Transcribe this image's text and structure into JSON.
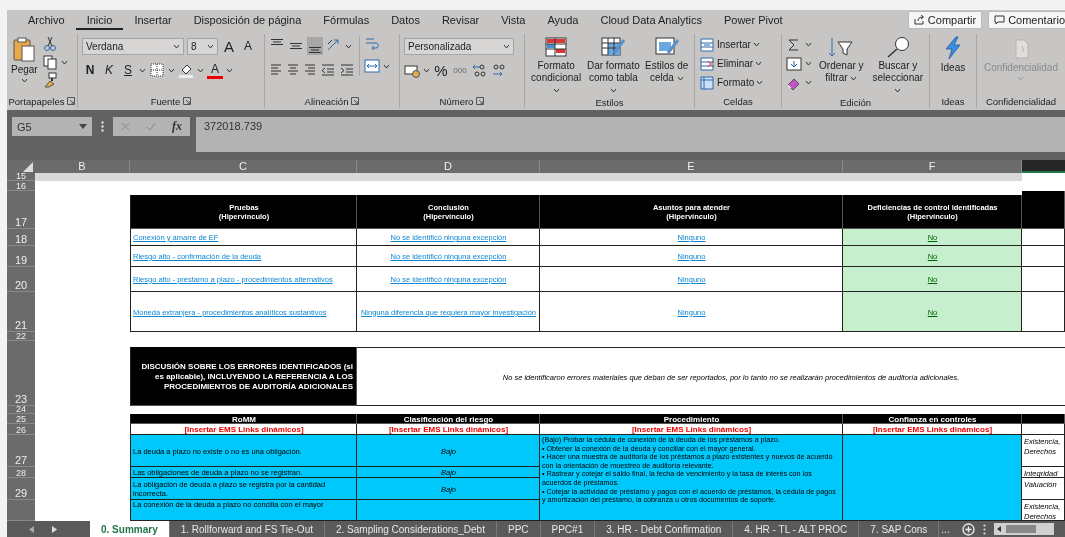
{
  "menu_tabs": [
    {
      "label": "Archivo",
      "selected": false
    },
    {
      "label": "Inicio",
      "selected": true
    },
    {
      "label": "Insertar",
      "selected": false
    },
    {
      "label": "Disposición de página",
      "selected": false
    },
    {
      "label": "Fórmulas",
      "selected": false
    },
    {
      "label": "Datos",
      "selected": false
    },
    {
      "label": "Revisar",
      "selected": false
    },
    {
      "label": "Vista",
      "selected": false
    },
    {
      "label": "Ayuda",
      "selected": false
    },
    {
      "label": "Cloud Data Analytics",
      "selected": false
    },
    {
      "label": "Power Pivot",
      "selected": false
    }
  ],
  "share_button": "Compartir",
  "comments_button": "Comentario",
  "ribbon": {
    "clipboard": {
      "label": "Portapapeles",
      "paste": "Pegar"
    },
    "font": {
      "label": "Fuente",
      "font_name": "Verdana",
      "font_size": "8",
      "grow": "A",
      "shrink": "A",
      "bold": "N",
      "italic": "K",
      "underline": "S",
      "font_color": "A"
    },
    "alignment": {
      "label": "Alineación",
      "vertical_align": [
        {
          "selected": false
        },
        {
          "selected": false
        },
        {
          "selected": true
        }
      ]
    },
    "number": {
      "label": "Número",
      "format": "Personalizada",
      "percent": "%",
      "thousands": "000"
    },
    "styles": {
      "label": "Estilos",
      "buttons": [
        "Formato condicional",
        "Dar formato como tabla",
        "Estilos de celda"
      ]
    },
    "cells": {
      "label": "Celdas",
      "buttons": [
        "Insertar",
        "Eliminar",
        "Formato"
      ]
    },
    "editing": {
      "label": "Edición",
      "buttons": [
        "Ordenar y filtrar",
        "Buscar y seleccionar"
      ]
    },
    "ideas": {
      "label": "Ideas",
      "button": "Ideas"
    },
    "sensitivity": {
      "label": "Confidencialidad",
      "button": "Confidencialidad",
      "disabled": true
    }
  },
  "formula_bar": {
    "name_box": "G5",
    "fx": "fx",
    "formula": "372018.739"
  },
  "columns": [
    {
      "label": "B"
    },
    {
      "label": "C"
    },
    {
      "label": "D"
    },
    {
      "label": "E"
    },
    {
      "label": "F"
    }
  ],
  "row_numbers": [
    "15",
    "16",
    "17",
    "18",
    "19",
    "20",
    "21",
    "22",
    "23",
    "24",
    "25",
    "26",
    "27",
    "28",
    "29"
  ],
  "summary_table": {
    "headers": [
      "Pruebas\n(Hipervínculo)",
      "Conclusión\n(Hipervínculo)",
      "Asuntos para atender\n(Hipervínculo)",
      "Deficiencias de control identificadas\n(Hipervínculo)"
    ],
    "rows": [
      {
        "test": "Conexión y amarre de EF",
        "conclusion": "No se identificó ninguna excepción",
        "matters": "Ninguno",
        "deficiencies": "No",
        "deficiency_found": false
      },
      {
        "test": "Riesgo alto - confirmación de la deuda",
        "conclusion": "No se identificó ninguna excepción",
        "matters": "Ninguno",
        "deficiencies": "No",
        "deficiency_found": false
      },
      {
        "test": "Riesgo alto - préstamo a plazo - procedimientos alternativos",
        "conclusion": "No se identificó ninguna excepción",
        "matters": "Ninguno",
        "deficiencies": "No",
        "deficiency_found": false
      },
      {
        "test": "Moneda extranjera - procedimientos analíticos sustantivos",
        "conclusion": "Ninguna diferencia que requiera mayor investigación",
        "matters": "Ninguno",
        "deficiencies": "No",
        "deficiency_found": false
      }
    ]
  },
  "discussion": {
    "title": "DISCUSIÓN SOBRE LOS ERRORES IDENTIFICADOS (si es aplicable), INCLUYENDO LA REFERENCIA A LOS PROCEDIMIENTOS DE AUDITORÍA ADICIONALES",
    "text": "No se identificaron errores materiales que deban de ser reportados, por lo tanto no se realizarán procedimientos de auditoría adicionales."
  },
  "risk_table": {
    "headers": [
      "RoMM",
      "Clasificación del riesgo",
      "Procedimiento",
      "Confianza en controles"
    ],
    "links": [
      "[Insertar EMS Links dinámicos]",
      "[Insertar EMS Links dinámicos]",
      "[Insertar EMS Links dinámicos]",
      "[Insertar EMS Links dinámicos]"
    ],
    "rows": [
      {
        "romm": "La deuda a plazo no existe o no es una obligación.",
        "rating": "Bajo",
        "assertion": "Existencia, Derechos"
      },
      {
        "romm": "Las obligaciones de deuda a plazo no se registran.",
        "rating": "Bajo",
        "assertion": "Integridad"
      },
      {
        "romm": "La obligación de deuda a plazo se registra por la cantidad incorrecta.",
        "rating": "Bajo",
        "assertion": "Valuación"
      },
      {
        "romm": "La conexión de la deuda a plazo no concilia con el mayor",
        "assertion": "Existencia, Derechos"
      }
    ],
    "procedure": [
      "(Bajo) Probar la cédula de conexión de la deuda de los préstamos a plazo.",
      "• Obtener la conexión de la deuda y conciliar con el mayor general.",
      "• Hacer una muestra de auditoría de los préstamos a plazo existentes y nuevos de acuerdo con la orientación de muestreo de auditoría relevante.",
      "• Rastrear y cotejar el saldo final, la fecha de vencimiento y la tasa de interés con los acuerdos de préstamos.",
      "• Cotejar la actividad de préstamo y pagos con el acuerdo de préstamos, la cédula de pagos y amortización del préstamo, la cobranza u otros documentos de soporte."
    ]
  },
  "sheet_tabs": [
    {
      "label": "0. Summary",
      "selected": true
    },
    {
      "label": "1. Rollforward and FS Tie-Out",
      "selected": false
    },
    {
      "label": "2. Sampling Considerations_Debt",
      "selected": false
    },
    {
      "label": "PPC",
      "selected": false
    },
    {
      "label": "PPC#1",
      "selected": false
    },
    {
      "label": "3. HR - Debt Confirmation",
      "selected": false
    },
    {
      "label": "4. HR - TL - ALT PROC",
      "selected": false
    },
    {
      "label": "7. SAP Cons",
      "selected": false
    }
  ],
  "more_tabs": "..."
}
